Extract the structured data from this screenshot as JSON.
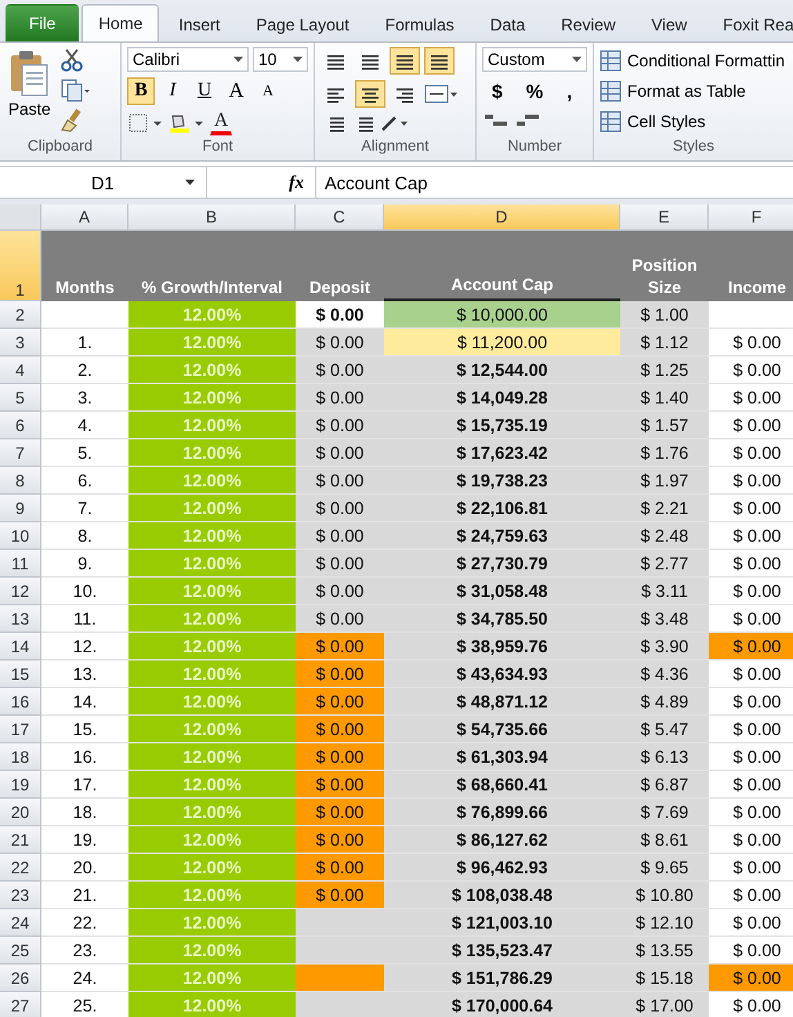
{
  "ribbon_tabs": [
    {
      "label": "File",
      "kind": "file",
      "selected": false
    },
    {
      "label": "Home",
      "kind": "tab",
      "selected": true
    },
    {
      "label": "Insert",
      "kind": "tab",
      "selected": false
    },
    {
      "label": "Page Layout",
      "kind": "tab",
      "selected": false
    },
    {
      "label": "Formulas",
      "kind": "tab",
      "selected": false
    },
    {
      "label": "Data",
      "kind": "tab",
      "selected": false
    },
    {
      "label": "Review",
      "kind": "tab",
      "selected": false
    },
    {
      "label": "View",
      "kind": "tab",
      "selected": false
    },
    {
      "label": "Foxit Rea",
      "kind": "tab",
      "selected": false
    }
  ],
  "clipboard": {
    "paste": "Paste",
    "label": "Clipboard"
  },
  "font": {
    "name": "Calibri",
    "size": "10",
    "label": "Font",
    "styles": [
      {
        "label": "B",
        "selected": true
      },
      {
        "label": "I",
        "selected": false
      },
      {
        "label": "U",
        "selected": false
      }
    ],
    "grow": "A",
    "shrink": "A",
    "color_letter": "A"
  },
  "alignment": {
    "label": "Alignment",
    "top_row": [
      false,
      false,
      true,
      true
    ],
    "middle_row": [
      false,
      true,
      false
    ]
  },
  "number": {
    "format": "Custom",
    "symbols": [
      "$",
      "%",
      ","
    ],
    "label": "Number"
  },
  "styles": {
    "items": [
      "Conditional Formattin",
      "Format as Table",
      "Cell Styles"
    ],
    "label": "Styles"
  },
  "formula_bar": {
    "name_box": "D1",
    "fx": "fx",
    "value": "Account Cap"
  },
  "columns": [
    {
      "letter": "A",
      "header": "Months",
      "color": "#ffffff",
      "selected": false
    },
    {
      "letter": "B",
      "header": "% Growth/Interval",
      "color": "#99cc00",
      "selected": false
    },
    {
      "letter": "C",
      "header": "Deposit",
      "color": "#d9d9d9",
      "selected": false
    },
    {
      "letter": "D",
      "header": "Account Cap",
      "color": "#d9d9d9",
      "selected": true
    },
    {
      "letter": "E",
      "header": "Position Size",
      "color": "#d9d9d9",
      "selected": false
    },
    {
      "letter": "F",
      "header": "Income",
      "color": "#ffffff",
      "selected": false
    }
  ],
  "header_row": {
    "num": "1",
    "selected": true
  },
  "rows": [
    {
      "num": "2",
      "cells": [
        {},
        {
          "text": "12.00%",
          "bold": true
        },
        {
          "text": "$ 0.00",
          "bold": true,
          "color": "#ffffff"
        },
        {
          "text": "$ 10,000.00",
          "bold": false,
          "color": "#a9d18e"
        },
        {
          "text": "$ 1.00",
          "bold": false
        },
        {}
      ]
    },
    {
      "num": "3",
      "cells": [
        {
          "text": "1.",
          "bold": false
        },
        {
          "text": "12.00%",
          "bold": true
        },
        {
          "text": "$ 0.00",
          "bold": false
        },
        {
          "text": "$ 11,200.00",
          "bold": false,
          "color": "#ffeb9c"
        },
        {
          "text": "$ 1.12",
          "bold": false
        },
        {
          "text": "$ 0.00",
          "bold": false
        }
      ]
    },
    {
      "num": "4",
      "cells": [
        {
          "text": "2.",
          "bold": false
        },
        {
          "text": "12.00%",
          "bold": true
        },
        {
          "text": "$ 0.00",
          "bold": false
        },
        {
          "text": "$ 12,544.00",
          "bold": true
        },
        {
          "text": "$ 1.25",
          "bold": false
        },
        {
          "text": "$ 0.00",
          "bold": false
        }
      ]
    },
    {
      "num": "5",
      "cells": [
        {
          "text": "3.",
          "bold": false
        },
        {
          "text": "12.00%",
          "bold": true
        },
        {
          "text": "$ 0.00",
          "bold": false
        },
        {
          "text": "$ 14,049.28",
          "bold": true
        },
        {
          "text": "$ 1.40",
          "bold": false
        },
        {
          "text": "$ 0.00",
          "bold": false
        }
      ]
    },
    {
      "num": "6",
      "cells": [
        {
          "text": "4.",
          "bold": false
        },
        {
          "text": "12.00%",
          "bold": true
        },
        {
          "text": "$ 0.00",
          "bold": false
        },
        {
          "text": "$ 15,735.19",
          "bold": true
        },
        {
          "text": "$ 1.57",
          "bold": false
        },
        {
          "text": "$ 0.00",
          "bold": false
        }
      ]
    },
    {
      "num": "7",
      "cells": [
        {
          "text": "5.",
          "bold": false
        },
        {
          "text": "12.00%",
          "bold": true
        },
        {
          "text": "$ 0.00",
          "bold": false
        },
        {
          "text": "$ 17,623.42",
          "bold": true
        },
        {
          "text": "$ 1.76",
          "bold": false
        },
        {
          "text": "$ 0.00",
          "bold": false
        }
      ]
    },
    {
      "num": "8",
      "cells": [
        {
          "text": "6.",
          "bold": false
        },
        {
          "text": "12.00%",
          "bold": true
        },
        {
          "text": "$ 0.00",
          "bold": false
        },
        {
          "text": "$ 19,738.23",
          "bold": true
        },
        {
          "text": "$ 1.97",
          "bold": false
        },
        {
          "text": "$ 0.00",
          "bold": false
        }
      ]
    },
    {
      "num": "9",
      "cells": [
        {
          "text": "7.",
          "bold": false
        },
        {
          "text": "12.00%",
          "bold": true
        },
        {
          "text": "$ 0.00",
          "bold": false
        },
        {
          "text": "$ 22,106.81",
          "bold": true
        },
        {
          "text": "$ 2.21",
          "bold": false
        },
        {
          "text": "$ 0.00",
          "bold": false
        }
      ]
    },
    {
      "num": "10",
      "cells": [
        {
          "text": "8.",
          "bold": false
        },
        {
          "text": "12.00%",
          "bold": true
        },
        {
          "text": "$ 0.00",
          "bold": false
        },
        {
          "text": "$ 24,759.63",
          "bold": true
        },
        {
          "text": "$ 2.48",
          "bold": false
        },
        {
          "text": "$ 0.00",
          "bold": false
        }
      ]
    },
    {
      "num": "11",
      "cells": [
        {
          "text": "9.",
          "bold": false
        },
        {
          "text": "12.00%",
          "bold": true
        },
        {
          "text": "$ 0.00",
          "bold": false
        },
        {
          "text": "$ 27,730.79",
          "bold": true
        },
        {
          "text": "$ 2.77",
          "bold": false
        },
        {
          "text": "$ 0.00",
          "bold": false
        }
      ]
    },
    {
      "num": "12",
      "cells": [
        {
          "text": "10.",
          "bold": false
        },
        {
          "text": "12.00%",
          "bold": true
        },
        {
          "text": "$ 0.00",
          "bold": false
        },
        {
          "text": "$ 31,058.48",
          "bold": true
        },
        {
          "text": "$ 3.11",
          "bold": false
        },
        {
          "text": "$ 0.00",
          "bold": false
        }
      ]
    },
    {
      "num": "13",
      "cells": [
        {
          "text": "11.",
          "bold": false
        },
        {
          "text": "12.00%",
          "bold": true
        },
        {
          "text": "$ 0.00",
          "bold": false
        },
        {
          "text": "$ 34,785.50",
          "bold": true
        },
        {
          "text": "$ 3.48",
          "bold": false
        },
        {
          "text": "$ 0.00",
          "bold": false
        }
      ]
    },
    {
      "num": "14",
      "cells": [
        {
          "text": "12.",
          "bold": false
        },
        {
          "text": "12.00%",
          "bold": true
        },
        {
          "text": "$ 0.00",
          "bold": false,
          "color": "#ff9900"
        },
        {
          "text": "$ 38,959.76",
          "bold": true
        },
        {
          "text": "$ 3.90",
          "bold": false
        },
        {
          "text": "$ 0.00",
          "bold": false,
          "color": "#ff9900"
        }
      ]
    },
    {
      "num": "15",
      "cells": [
        {
          "text": "13.",
          "bold": false
        },
        {
          "text": "12.00%",
          "bold": true
        },
        {
          "text": "$ 0.00",
          "bold": false,
          "color": "#ff9900"
        },
        {
          "text": "$ 43,634.93",
          "bold": true
        },
        {
          "text": "$ 4.36",
          "bold": false
        },
        {
          "text": "$ 0.00",
          "bold": false
        }
      ]
    },
    {
      "num": "16",
      "cells": [
        {
          "text": "14.",
          "bold": false
        },
        {
          "text": "12.00%",
          "bold": true
        },
        {
          "text": "$ 0.00",
          "bold": false,
          "color": "#ff9900"
        },
        {
          "text": "$ 48,871.12",
          "bold": true
        },
        {
          "text": "$ 4.89",
          "bold": false
        },
        {
          "text": "$ 0.00",
          "bold": false
        }
      ]
    },
    {
      "num": "17",
      "cells": [
        {
          "text": "15.",
          "bold": false
        },
        {
          "text": "12.00%",
          "bold": true
        },
        {
          "text": "$ 0.00",
          "bold": false,
          "color": "#ff9900"
        },
        {
          "text": "$ 54,735.66",
          "bold": true
        },
        {
          "text": "$ 5.47",
          "bold": false
        },
        {
          "text": "$ 0.00",
          "bold": false
        }
      ]
    },
    {
      "num": "18",
      "cells": [
        {
          "text": "16.",
          "bold": false
        },
        {
          "text": "12.00%",
          "bold": true
        },
        {
          "text": "$ 0.00",
          "bold": false,
          "color": "#ff9900"
        },
        {
          "text": "$ 61,303.94",
          "bold": true
        },
        {
          "text": "$ 6.13",
          "bold": false
        },
        {
          "text": "$ 0.00",
          "bold": false
        }
      ]
    },
    {
      "num": "19",
      "cells": [
        {
          "text": "17.",
          "bold": false
        },
        {
          "text": "12.00%",
          "bold": true
        },
        {
          "text": "$ 0.00",
          "bold": false,
          "color": "#ff9900"
        },
        {
          "text": "$ 68,660.41",
          "bold": true
        },
        {
          "text": "$ 6.87",
          "bold": false
        },
        {
          "text": "$ 0.00",
          "bold": false
        }
      ]
    },
    {
      "num": "20",
      "cells": [
        {
          "text": "18.",
          "bold": false
        },
        {
          "text": "12.00%",
          "bold": true
        },
        {
          "text": "$ 0.00",
          "bold": false,
          "color": "#ff9900"
        },
        {
          "text": "$ 76,899.66",
          "bold": true
        },
        {
          "text": "$ 7.69",
          "bold": false
        },
        {
          "text": "$ 0.00",
          "bold": false
        }
      ]
    },
    {
      "num": "21",
      "cells": [
        {
          "text": "19.",
          "bold": false
        },
        {
          "text": "12.00%",
          "bold": true
        },
        {
          "text": "$ 0.00",
          "bold": false,
          "color": "#ff9900"
        },
        {
          "text": "$ 86,127.62",
          "bold": true
        },
        {
          "text": "$ 8.61",
          "bold": false
        },
        {
          "text": "$ 0.00",
          "bold": false
        }
      ]
    },
    {
      "num": "22",
      "cells": [
        {
          "text": "20.",
          "bold": false
        },
        {
          "text": "12.00%",
          "bold": true
        },
        {
          "text": "$ 0.00",
          "bold": false,
          "color": "#ff9900"
        },
        {
          "text": "$ 96,462.93",
          "bold": true
        },
        {
          "text": "$ 9.65",
          "bold": false
        },
        {
          "text": "$ 0.00",
          "bold": false
        }
      ]
    },
    {
      "num": "23",
      "cells": [
        {
          "text": "21.",
          "bold": false
        },
        {
          "text": "12.00%",
          "bold": true
        },
        {
          "text": "$ 0.00",
          "bold": false,
          "color": "#ff9900"
        },
        {
          "text": "$ 108,038.48",
          "bold": true
        },
        {
          "text": "$ 10.80",
          "bold": false
        },
        {
          "text": "$ 0.00",
          "bold": false
        }
      ]
    },
    {
      "num": "24",
      "cells": [
        {
          "text": "22.",
          "bold": false
        },
        {
          "text": "12.00%",
          "bold": true
        },
        {},
        {
          "text": "$ 121,003.10",
          "bold": true
        },
        {
          "text": "$ 12.10",
          "bold": false
        },
        {
          "text": "$ 0.00",
          "bold": false
        }
      ]
    },
    {
      "num": "25",
      "cells": [
        {
          "text": "23.",
          "bold": false
        },
        {
          "text": "12.00%",
          "bold": true
        },
        {},
        {
          "text": "$ 135,523.47",
          "bold": true
        },
        {
          "text": "$ 13.55",
          "bold": false
        },
        {
          "text": "$ 0.00",
          "bold": false
        }
      ]
    },
    {
      "num": "26",
      "cells": [
        {
          "text": "24.",
          "bold": false
        },
        {
          "text": "12.00%",
          "bold": true
        },
        {
          "color": "#ff9900"
        },
        {
          "text": "$ 151,786.29",
          "bold": true
        },
        {
          "text": "$ 15.18",
          "bold": false
        },
        {
          "text": "$ 0.00",
          "bold": false,
          "color": "#ff9900"
        }
      ]
    },
    {
      "num": "27",
      "cells": [
        {
          "text": "25.",
          "bold": false
        },
        {
          "text": "12.00%",
          "bold": true
        },
        {},
        {
          "text": "$ 170,000.64",
          "bold": true
        },
        {
          "text": "$ 17.00",
          "bold": false
        },
        {
          "text": "$ 0.00",
          "bold": false
        }
      ]
    }
  ]
}
